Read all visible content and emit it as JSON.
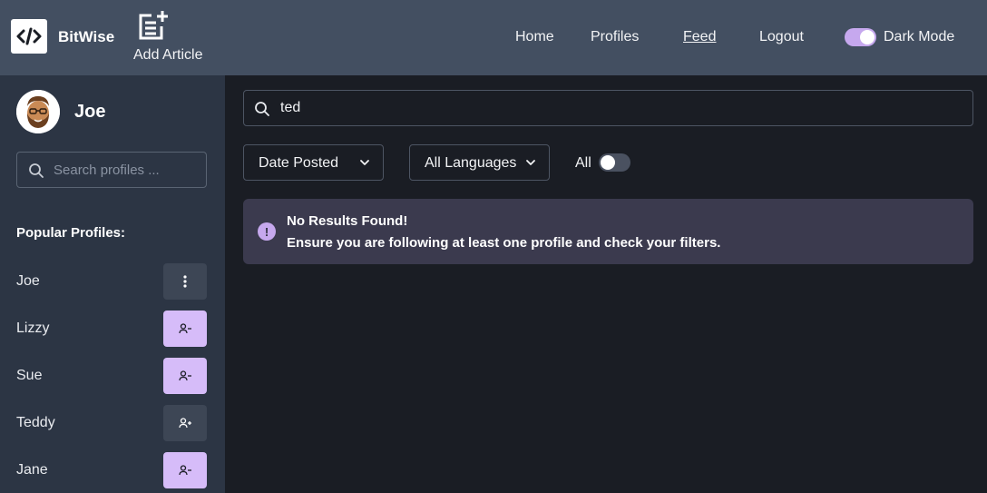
{
  "header": {
    "brand": "BitWise",
    "add_article_label": "Add Article",
    "nav": [
      {
        "label": "Home",
        "active": false
      },
      {
        "label": "Profiles",
        "active": false
      },
      {
        "label": "Feed",
        "active": true
      },
      {
        "label": "Logout",
        "active": false
      }
    ],
    "dark_mode_label": "Dark Mode",
    "dark_mode_on": true
  },
  "sidebar": {
    "user_name": "Joe",
    "search_placeholder": "Search profiles ...",
    "popular_title": "Popular Profiles:",
    "profiles": [
      {
        "name": "Joe",
        "action": "more-options",
        "icon": "more-vertical-icon"
      },
      {
        "name": "Lizzy",
        "action": "unfollow",
        "icon": "user-minus-icon"
      },
      {
        "name": "Sue",
        "action": "unfollow",
        "icon": "user-minus-icon"
      },
      {
        "name": "Teddy",
        "action": "follow",
        "icon": "user-plus-icon"
      },
      {
        "name": "Jane",
        "action": "unfollow",
        "icon": "user-minus-icon"
      }
    ]
  },
  "main": {
    "search_value": "ted",
    "sort_label": "Date Posted",
    "language_label": "All Languages",
    "all_label": "All",
    "all_toggle_on": false,
    "alert_title": "No Results Found!",
    "alert_message": "Ensure you are following at least one profile and check your filters."
  },
  "colors": {
    "header_bg": "#434f61",
    "sidebar_bg": "#2c3544",
    "main_bg": "#1a1d24",
    "accent": "#d6bcf9",
    "alert_bg": "#3b3a4e"
  }
}
